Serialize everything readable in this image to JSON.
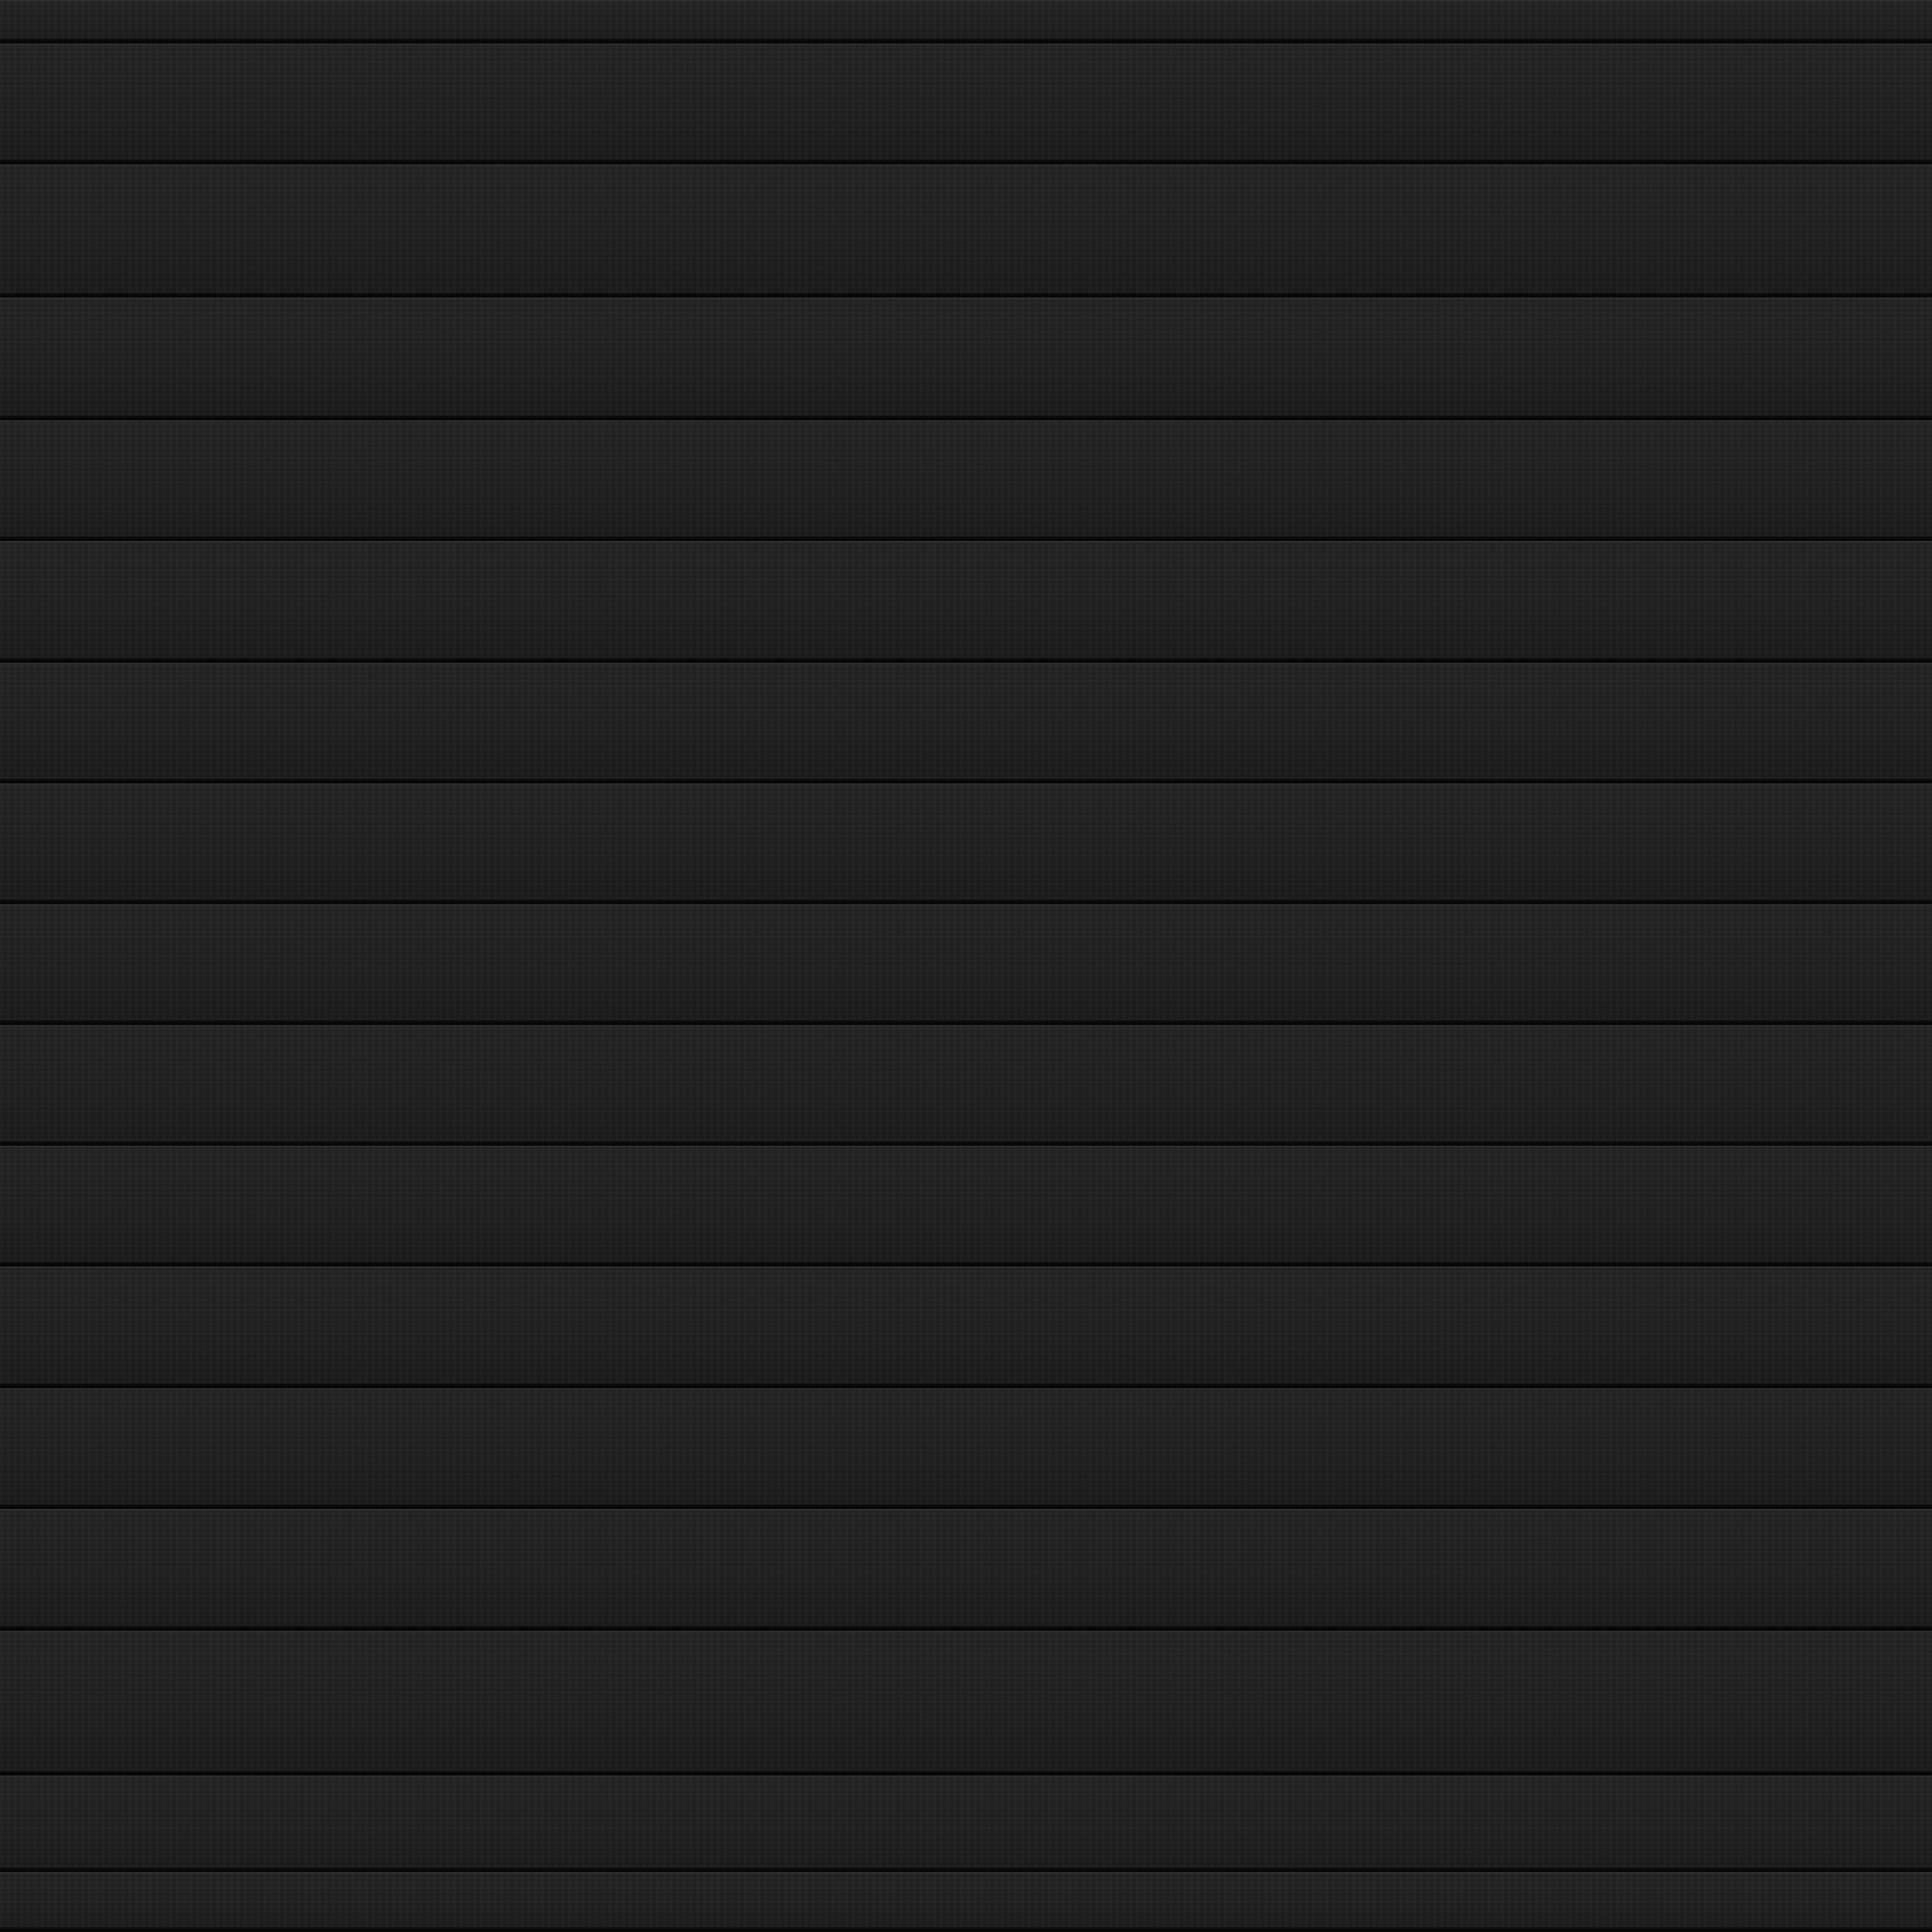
{
  "scene": {
    "subject": "painted-horizontal-siding",
    "board_count": 16,
    "colors": {
      "board": "#1e1e1e",
      "seam_shadow": "#050505",
      "highlight": "#2a2a2a"
    }
  }
}
